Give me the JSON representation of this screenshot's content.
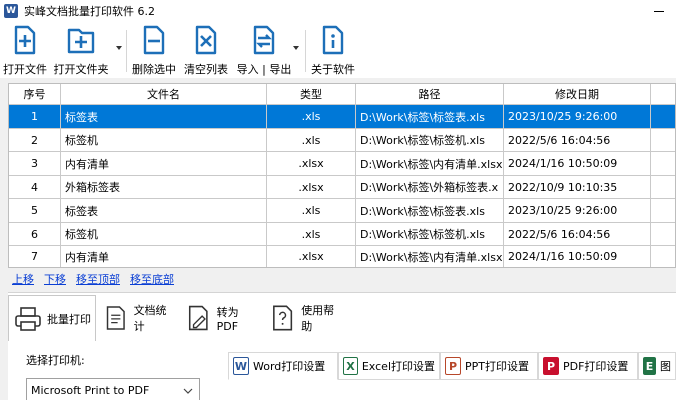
{
  "window": {
    "title": "实峰文档批量打印软件 6.2",
    "app_icon_letter": "W"
  },
  "toolbar": {
    "buttons": [
      {
        "label": "打开文件",
        "icon": "file-add-icon"
      },
      {
        "label": "打开文件夹",
        "icon": "folder-add-icon"
      },
      {
        "label": "删除选中",
        "icon": "file-remove-icon"
      },
      {
        "label": "清空列表",
        "icon": "file-clear-icon"
      },
      {
        "label": "导入 | 导出",
        "icon": "import-export-icon"
      },
      {
        "label": "关于软件",
        "icon": "info-icon"
      }
    ]
  },
  "table": {
    "columns": [
      "序号",
      "文件名",
      "类型",
      "路径",
      "修改日期"
    ],
    "selected_row": 0,
    "rows": [
      {
        "no": "1",
        "name": "标签表",
        "type": ".xls",
        "path": "D:\\Work\\标签\\标签表.xls",
        "date": "2023/10/25 9:26:00"
      },
      {
        "no": "2",
        "name": "标签机",
        "type": ".xls",
        "path": "D:\\Work\\标签\\标签机.xls",
        "date": "2022/5/6 16:04:56"
      },
      {
        "no": "3",
        "name": "内有清单",
        "type": ".xlsx",
        "path": "D:\\Work\\标签\\内有清单.xlsx",
        "date": "2024/1/16 10:50:09"
      },
      {
        "no": "4",
        "name": "外箱标签表",
        "type": ".xlsx",
        "path": "D:\\Work\\标签\\外箱标签表.x",
        "date": "2022/10/9 10:10:35"
      },
      {
        "no": "5",
        "name": "标签表",
        "type": ".xls",
        "path": "D:\\Work\\标签\\标签表.xls",
        "date": "2023/10/25 9:26:00"
      },
      {
        "no": "6",
        "name": "标签机",
        "type": ".xls",
        "path": "D:\\Work\\标签\\标签机.xls",
        "date": "2022/5/6 16:04:56"
      },
      {
        "no": "7",
        "name": "内有清单",
        "type": ".xlsx",
        "path": "D:\\Work\\标签\\内有清单.xlsx",
        "date": "2024/1/16 10:50:09"
      }
    ]
  },
  "move_links": [
    "上移",
    "下移",
    "移至顶部",
    "移至底部"
  ],
  "main_tabs": [
    {
      "label": "批量打印",
      "icon": "printer-icon"
    },
    {
      "label": "文档统计",
      "icon": "document-stats-icon"
    },
    {
      "label": "转为PDF",
      "icon": "convert-pdf-icon"
    },
    {
      "label": "使用帮助",
      "icon": "help-icon"
    }
  ],
  "printer": {
    "label": "选择打印机:",
    "selected": "Microsoft Print to PDF"
  },
  "settings_tabs": [
    {
      "label": "Word打印设置",
      "icon_letter": "W",
      "color": "#2b579a"
    },
    {
      "label": "Excel打印设置",
      "icon_letter": "X",
      "color": "#217346"
    },
    {
      "label": "PPT打印设置",
      "icon_letter": "P",
      "color": "#b7472a"
    },
    {
      "label": "PDF打印设置",
      "icon_letter": "P",
      "color": "#c8102e"
    },
    {
      "label": "图",
      "icon_letter": "E",
      "color": "#217346"
    }
  ],
  "colors": {
    "selection": "#0078d7",
    "link": "#0b3fd4",
    "icon_blue": "#1d6fb8"
  }
}
